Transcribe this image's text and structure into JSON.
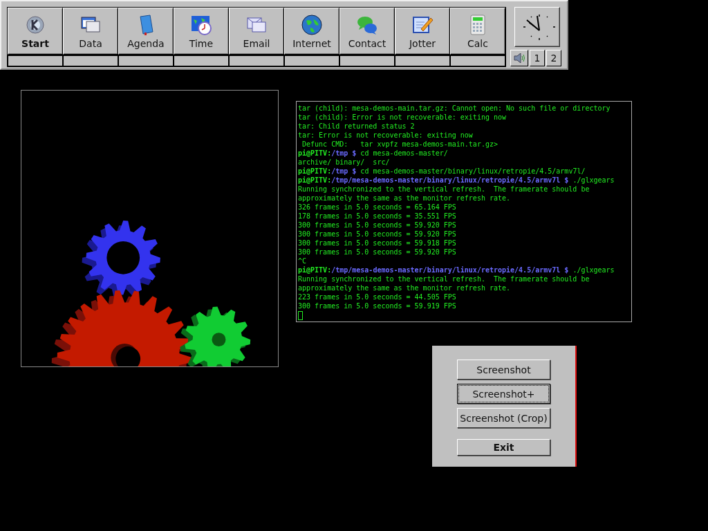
{
  "panel": {
    "launchers": [
      {
        "label": "Start",
        "emphasized": true
      },
      {
        "label": "Data",
        "emphasized": false
      },
      {
        "label": "Agenda",
        "emphasized": false
      },
      {
        "label": "Time",
        "emphasized": false
      },
      {
        "label": "Email",
        "emphasized": false
      },
      {
        "label": "Internet",
        "emphasized": false
      },
      {
        "label": "Contact",
        "emphasized": false
      },
      {
        "label": "Jotter",
        "emphasized": false
      },
      {
        "label": "Calc",
        "emphasized": false
      }
    ],
    "desktops": [
      "1",
      "2"
    ]
  },
  "terminal": {
    "lines": [
      {
        "kind": "output",
        "text": "tar (child): mesa-demos-main.tar.gz: Cannot open: No such file or directory"
      },
      {
        "kind": "output",
        "text": "tar (child): Error is not recoverable: exiting now"
      },
      {
        "kind": "output",
        "text": "tar: Child returned status 2"
      },
      {
        "kind": "output",
        "text": "tar: Error is not recoverable: exiting now"
      },
      {
        "kind": "output",
        "text": " Defunc CMD:   tar xvpfz mesa-demos-main.tar.gz>"
      },
      {
        "kind": "prompt",
        "user": "pi@PITV:",
        "path": "/tmp",
        "sign": "$",
        "command": "cd mesa-demos-master/"
      },
      {
        "kind": "output",
        "text": "archive/ binary/  src/"
      },
      {
        "kind": "prompt",
        "user": "pi@PITV:",
        "path": "/tmp",
        "sign": "$",
        "command": "cd mesa-demos-master/binary/linux/retropie/4.5/armv7l/"
      },
      {
        "kind": "prompt",
        "user": "pi@PITV:",
        "path": "/tmp/mesa-demos-master/binary/linux/retropie/4.5/armv7l",
        "sign": "$",
        "command": "./glxgears"
      },
      {
        "kind": "output",
        "text": "Running synchronized to the vertical refresh.  The framerate should be"
      },
      {
        "kind": "output",
        "text": "approximately the same as the monitor refresh rate."
      },
      {
        "kind": "output",
        "text": "326 frames in 5.0 seconds = 65.164 FPS"
      },
      {
        "kind": "output",
        "text": "178 frames in 5.0 seconds = 35.551 FPS"
      },
      {
        "kind": "output",
        "text": "300 frames in 5.0 seconds = 59.920 FPS"
      },
      {
        "kind": "output",
        "text": "300 frames in 5.0 seconds = 59.920 FPS"
      },
      {
        "kind": "output",
        "text": "300 frames in 5.0 seconds = 59.918 FPS"
      },
      {
        "kind": "output",
        "text": "300 frames in 5.0 seconds = 59.920 FPS"
      },
      {
        "kind": "output",
        "text": "^C"
      },
      {
        "kind": "prompt",
        "user": "pi@PITV:",
        "path": "/tmp/mesa-demos-master/binary/linux/retropie/4.5/armv7l",
        "sign": "$",
        "command": "./glxgears"
      },
      {
        "kind": "output",
        "text": "Running synchronized to the vertical refresh.  The framerate should be"
      },
      {
        "kind": "output",
        "text": "approximately the same as the monitor refresh rate."
      },
      {
        "kind": "output",
        "text": "223 frames in 5.0 seconds = 44.505 FPS"
      },
      {
        "kind": "output",
        "text": "300 frames in 5.0 seconds = 59.919 FPS"
      },
      {
        "kind": "cursor"
      }
    ]
  },
  "dialog": {
    "buttons": [
      {
        "label": "Screenshot",
        "focused": false,
        "emphasized": false
      },
      {
        "label": "Screenshot+",
        "focused": true,
        "emphasized": false
      },
      {
        "label": "Screenshot (Crop)",
        "focused": false,
        "emphasized": false
      },
      {
        "label": "Exit",
        "focused": false,
        "emphasized": true
      }
    ]
  }
}
